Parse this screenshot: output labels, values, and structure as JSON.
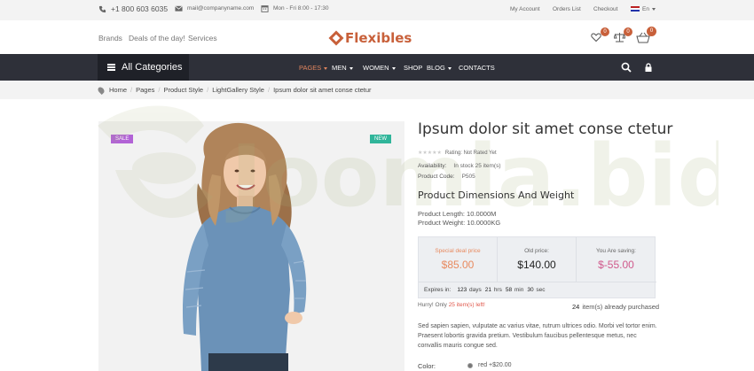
{
  "topbar": {
    "phone": "+1 800 603 6035",
    "email": "mail@companyname.com",
    "hours": "Mon - Fri 8:00 - 17:30",
    "my_account": "My Account",
    "orders_list": "Orders List",
    "checkout": "Checkout",
    "language": "En"
  },
  "header": {
    "links": [
      "Brands",
      "Deals of the day!",
      "Services"
    ],
    "logo_text": "Flexibles",
    "wishlist_count": "0",
    "compare_count": "0",
    "cart_count": "0"
  },
  "nav": {
    "all_categories": "All Categories",
    "items": [
      "PAGES",
      "MEN",
      "WOMEN",
      "SHOP",
      "BLOG",
      "CONTACTS"
    ]
  },
  "breadcrumb": [
    "Home",
    "Pages",
    "Product Style",
    "LightGallery Style",
    "Ipsum dolor sit amet conse ctetur"
  ],
  "watermark": "Joomla.bid",
  "product": {
    "sale_tag": "SALE",
    "new_tag": "NEW",
    "title": "Ipsum dolor sit amet conse ctetur",
    "rating_text": "Rating: Not Rated Yet",
    "availability_label": "Availability:",
    "availability_value": "In stock 25 item(s)",
    "code_label": "Product Code:",
    "code_value": "P505",
    "dimensions_heading": "Product Dimensions And Weight",
    "length": "Product Length: 10.0000M",
    "weight": "Product Weight: 10.0000KG"
  },
  "pricing": {
    "deal_label": "Special deal price",
    "deal_value": "$85.00",
    "old_label": "Old price:",
    "old_value": "$140.00",
    "saving_label": "You Are saving:",
    "saving_value": "$-55.00",
    "expires_label": "Expires in:",
    "days": "123",
    "days_unit": "days",
    "hrs": "21",
    "hrs_unit": "hrs",
    "min": "58",
    "min_unit": "min",
    "sec": "30",
    "sec_unit": "sec"
  },
  "stock": {
    "hurry_prefix": "Hurry! Only",
    "hurry_count": "25 item(s) left!",
    "purchased_count": "24",
    "purchased_text": "item(s) already purchased"
  },
  "description": "Sed sapien sapien, vulputate ac varius vitae, rutrum ultrices odio. Morbi vel tortor enim. Praesent lobortis gravida pretium. Vestibulum faucibus pellentesque metus, nec convallis mauris congue sed.",
  "options": {
    "color_label": "Color:",
    "color_value": "red +$20.00"
  },
  "colors": {
    "accent": "#e0855e",
    "brand": "#c8603a",
    "nav_bg": "#2e3039",
    "deal": "#e88a5f",
    "saving": "#d05a8c"
  }
}
